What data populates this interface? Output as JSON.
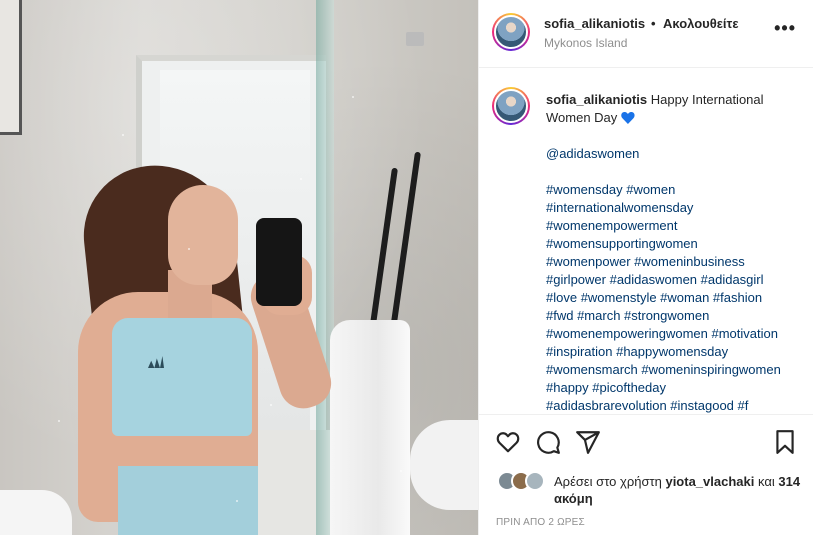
{
  "photo": {
    "alt": ""
  },
  "header": {
    "username": "sofia_alikaniotis",
    "separator": "•",
    "follow_status": "Ακολουθείτε",
    "location": "Mykonos Island",
    "more_icon": "more-horizontal-icon"
  },
  "caption": {
    "username": "sofia_alikaniotis",
    "text": "Happy International Women Day",
    "emoji": "blue-heart-icon",
    "mention": "@adidaswomen",
    "hashtag_lines": [
      "#womensday #women",
      "#internationalwomensday",
      "#womenempowerment",
      "#womensupportingwomen",
      "#womenpower #womeninbusiness",
      "#girlpower #adidaswomen #adidasgirl",
      "#love #womenstyle #woman #fashion",
      "#fwd #march #strongwomen",
      "#womenempoweringwomen #motivation",
      "#inspiration #happywomensday",
      "#womensmarch #womeninspiringwomen",
      "#happy #picoftheday",
      "#adidasbrarevolution #instagood #f"
    ]
  },
  "actions": {
    "like_icon": "heart-icon",
    "comment_icon": "comment-icon",
    "share_icon": "paper-plane-icon",
    "save_icon": "bookmark-icon"
  },
  "likes": {
    "prefix": "Αρέσει στο χρήστη",
    "user": "yiota_vlachaki",
    "suffix": "και",
    "others": "314 ακόμη"
  },
  "timestamp": "ΠΡΙΝ ΑΠΟ 2 ΩΡΕΣ",
  "colors": {
    "link": "#00376b",
    "text": "#262626",
    "muted": "#8e8e8e",
    "heart_emoji": "#1a73e8"
  }
}
